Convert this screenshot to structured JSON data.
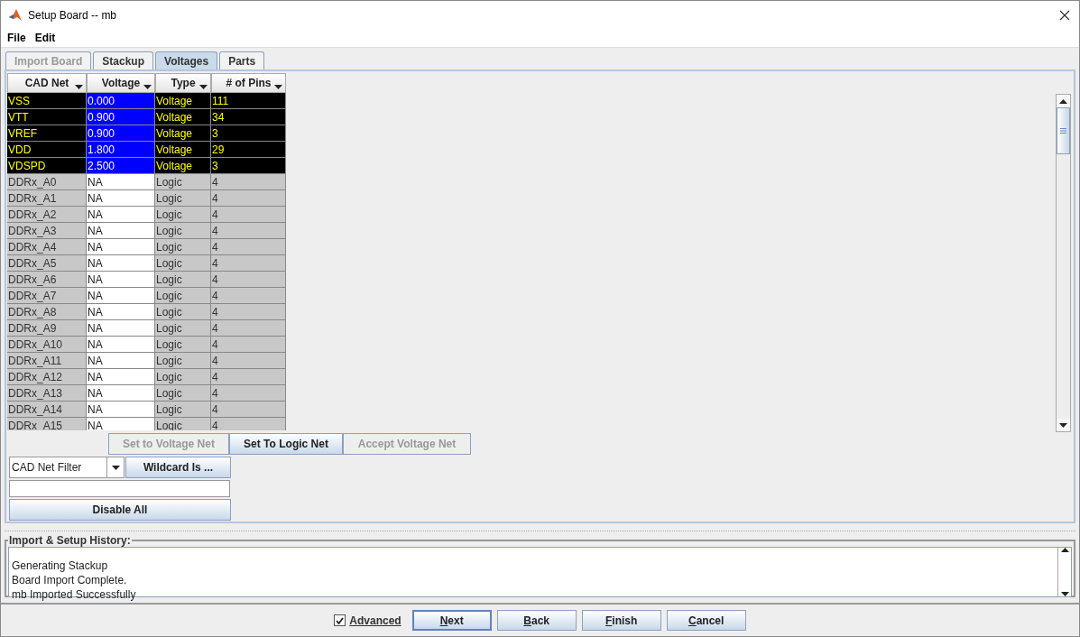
{
  "window": {
    "title": "Setup Board -- mb"
  },
  "menu": [
    "File",
    "Edit"
  ],
  "tabs": [
    {
      "label": "Import Board",
      "selected": false,
      "disabled": true
    },
    {
      "label": "Stackup",
      "selected": false,
      "disabled": false
    },
    {
      "label": "Voltages",
      "selected": true,
      "disabled": false
    },
    {
      "label": "Parts",
      "selected": false,
      "disabled": false
    }
  ],
  "table": {
    "columns": [
      "CAD Net",
      "Voltage",
      "Type",
      "# of Pins"
    ],
    "rows": [
      {
        "kind": "voltage",
        "cells": [
          "VSS",
          "0.000",
          "Voltage",
          "111"
        ]
      },
      {
        "kind": "voltage",
        "cells": [
          "VTT",
          "0.900",
          "Voltage",
          "34"
        ]
      },
      {
        "kind": "voltage",
        "cells": [
          "VREF",
          "0.900",
          "Voltage",
          "3"
        ]
      },
      {
        "kind": "voltage",
        "cells": [
          "VDD",
          "1.800",
          "Voltage",
          "29"
        ]
      },
      {
        "kind": "voltage",
        "cells": [
          "VDSPD",
          "2.500",
          "Voltage",
          "3"
        ]
      },
      {
        "kind": "logic",
        "cells": [
          "DDRx_A0",
          "NA",
          "Logic",
          "4"
        ]
      },
      {
        "kind": "logic",
        "cells": [
          "DDRx_A1",
          "NA",
          "Logic",
          "4"
        ]
      },
      {
        "kind": "logic",
        "cells": [
          "DDRx_A2",
          "NA",
          "Logic",
          "4"
        ]
      },
      {
        "kind": "logic",
        "cells": [
          "DDRx_A3",
          "NA",
          "Logic",
          "4"
        ]
      },
      {
        "kind": "logic",
        "cells": [
          "DDRx_A4",
          "NA",
          "Logic",
          "4"
        ]
      },
      {
        "kind": "logic",
        "cells": [
          "DDRx_A5",
          "NA",
          "Logic",
          "4"
        ]
      },
      {
        "kind": "logic",
        "cells": [
          "DDRx_A6",
          "NA",
          "Logic",
          "4"
        ]
      },
      {
        "kind": "logic",
        "cells": [
          "DDRx_A7",
          "NA",
          "Logic",
          "4"
        ]
      },
      {
        "kind": "logic",
        "cells": [
          "DDRx_A8",
          "NA",
          "Logic",
          "4"
        ]
      },
      {
        "kind": "logic",
        "cells": [
          "DDRx_A9",
          "NA",
          "Logic",
          "4"
        ]
      },
      {
        "kind": "logic",
        "cells": [
          "DDRx_A10",
          "NA",
          "Logic",
          "4"
        ]
      },
      {
        "kind": "logic",
        "cells": [
          "DDRx_A11",
          "NA",
          "Logic",
          "4"
        ]
      },
      {
        "kind": "logic",
        "cells": [
          "DDRx_A12",
          "NA",
          "Logic",
          "4"
        ]
      },
      {
        "kind": "logic",
        "cells": [
          "DDRx_A13",
          "NA",
          "Logic",
          "4"
        ]
      },
      {
        "kind": "logic",
        "cells": [
          "DDRx_A14",
          "NA",
          "Logic",
          "4"
        ]
      },
      {
        "kind": "logic",
        "cells": [
          "DDRx_A15",
          "NA",
          "Logic",
          "4"
        ]
      }
    ]
  },
  "net_actions": [
    {
      "label": "Set to Voltage Net",
      "disabled": true
    },
    {
      "label": "Set To Logic Net",
      "disabled": false
    },
    {
      "label": "Accept Voltage Net",
      "disabled": true
    }
  ],
  "filter": {
    "dropdown": "CAD Net Filter",
    "wildcard_button": "Wildcard Is ...",
    "disable_all_button": "Disable All"
  },
  "history": {
    "title": "Import & Setup History:",
    "lines": [
      "Generating Stackup",
      "Board Import Complete.",
      "mb Imported Successfully"
    ]
  },
  "footer": {
    "advanced": {
      "label": "Advanced",
      "checked": true
    },
    "buttons": [
      {
        "label": "Next",
        "selected": true
      },
      {
        "label": "Back",
        "selected": false
      },
      {
        "label": "Finish",
        "selected": false
      },
      {
        "label": "Cancel",
        "selected": false
      }
    ]
  }
}
